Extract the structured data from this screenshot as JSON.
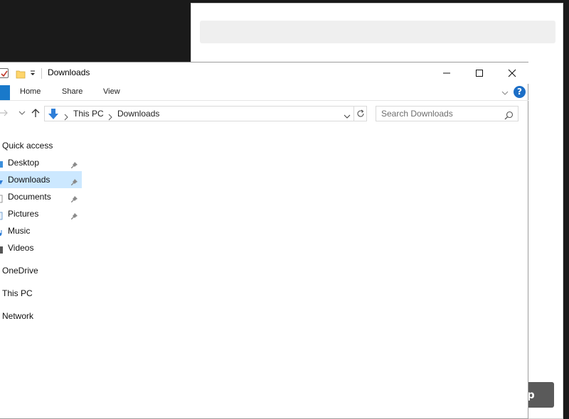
{
  "window": {
    "title": "Downloads"
  },
  "ribbon": {
    "tabs": [
      {
        "label": "Home"
      },
      {
        "label": "Share"
      },
      {
        "label": "View"
      }
    ],
    "help_label": "?"
  },
  "address": {
    "crumbs": [
      "This PC",
      "Downloads"
    ]
  },
  "search": {
    "placeholder": "Search Downloads"
  },
  "navpane": {
    "quick_access": "Quick access",
    "items": [
      {
        "label": "Desktop",
        "icon": "desktop-icon",
        "pinned": true
      },
      {
        "label": "Downloads",
        "icon": "downloads-icon",
        "pinned": true,
        "selected": true
      },
      {
        "label": "Documents",
        "icon": "documents-icon",
        "pinned": true
      },
      {
        "label": "Pictures",
        "icon": "pictures-icon",
        "pinned": true
      },
      {
        "label": "Music",
        "icon": "music-icon",
        "pinned": false
      },
      {
        "label": "Videos",
        "icon": "videos-icon",
        "pinned": false
      }
    ],
    "onedrive": "OneDrive",
    "this_pc": "This PC",
    "network": "Network"
  },
  "background_window": {
    "button_label": "p"
  },
  "colors": {
    "accent": "#1979ca",
    "selection": "#cce8ff",
    "desktop": "#1a1a1a"
  }
}
